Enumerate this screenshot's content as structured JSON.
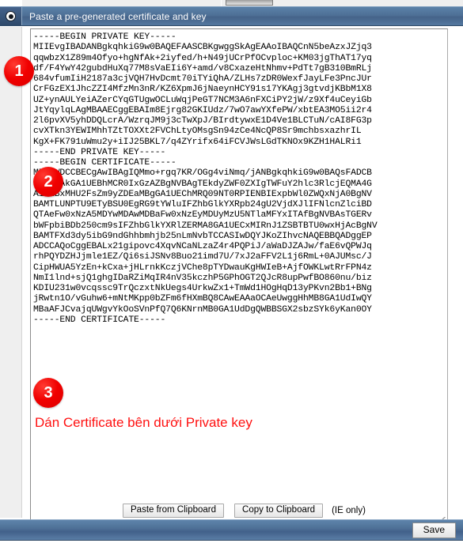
{
  "window": {
    "title": "Paste a pre-generated certificate and key",
    "title_icon": "radio-selected-icon",
    "accent_color": "#4e7096",
    "badge_color": "#f00000",
    "annotation_color": "#ff1010"
  },
  "editor": {
    "name": "certificate-and-key-textarea",
    "placeholder": "",
    "value": "-----BEGIN PRIVATE KEY-----\nMIIEvgIBADANBgkqhkiG9w0BAQEFAASCBKgwggSkAgEAAoIBAQCnN5beAzxJZjq3\nqqwbzX1Z89m4Ofyo+hgNfAk+2iyfed/h+N49jUCrPfOCvploc+KM03jgThAT17yq\ndf/F4YwY42gubdHuXq77M8sVaEIi6Y+amd/v8CxazeHtNhmv+PdTt7gB310BmRLj\n684vfumIiH2187a3cjVQH7HvDcmt70iTYiQhA/ZLHs7zDR0WexfJayLFe3PncJUr\nCrFGzEX1JhcZZI4MfzMn3nR/KZ6XpmJ6jNaeynHCY91s17YKAgj3gtvdjKBbM1X8\nUZ+ynAULYeiAZerCYqGTUgwOCLuWqjPeGT7NCM3A6nFXCiPY2jW/z9Xf4uCeyiGb\nJtYqylqLAgMBAAECggEBAIm8Ejrg82GKIUdz/7wO7awYXfePW/xbtEA3MO5ii2r4\n2l6pvXV5yhDDQLcrA/WzrqJM9j3cTwXpJ/BIrdtywxE1D4Ve1BLCTuN/cAI8FG3p\ncvXTkn3YEWIMhhTZtTOXXt2FVChLtyOMsgSn94zCe4NcQP8Sr9mchbsxazhrIL\nKgX+FK791uWmu2y+iIJ25BKL7/q4ZYrifx64iFCVJWsLGdTKNOx9KZH1HALRi1\n-----END PRIVATE KEY-----\n-----BEGIN CERTIFICATE-----\nMIIFWDCCBECgAwIBAgIQMmo+rgq7KR/OGg4viNmq/jANBgkqhkiG9w0BAQsFADCB\nkDELMAkGA1UEBhMCR0IxGzAZBgNVBAgTEkdyZWF0ZXIgTWFuY2hlc3RlcjEQMA4G\nA1UEBxMHU2FsZm9yZDEaMBgGA1UEChMRQ09NT0RPIENBIExpbWl0ZWQxNjA0BgNV\nBAMTLUNPTU9ETyBSU0EgRG9tYWluIFZhbGlkYXRpb24gU2VjdXJlIFNlcnZlciBD\nQTAeFw0xNzA5MDYwMDAwMDBaFw0xNzEyMDUyMzU5NTlaMFYxITAfBgNVBAsTGERv\nbWFpbiBDb250cm9sIFZhbGlkYXRlZERMA8GA1UECxMIRnJ1ZSBTBTU0wxHjAcBgNV\nBAMTFXd3dy5ibG9ndGhhbmhjb25nLmNvbTCCASIwDQYJKoZIhvcNAQEBBQADggEP\nADCCAQoCggEBALx21gipovc4XqvNCaNLzaZ4r4PQPiJ/aWaDJZAJw/faE6vQPWJq\nrhPQYDZHJjmle1EZ/Qi6siJSNv8Buo21imd7U/7xJ2aFFV2L1j6RmL+0AJUMsc/J\nCipHWUA5YzEn+kCxa+jHLrnkKczjVChe8pTYDwauKgHWIeB+AjfOWKLwtRrFPN4z\nNmI1lnd+sjQ1ghgIDaRZiMqIR4nV35kczhP5GPhOGT2QJcR8upPwfBO860nu/biz\nKDIU231w0vcqssc9TrQczxtNkUegs4UrkwZx1+TmWd1HOgHqD13yPKvn2Bb1+BNg\njRwtn1O/vGuhw6+mNtMKpp0bZFm6fHXmBQ8CAwEAAaOCAeUwggHhMB8GA1UdIwQY\nMBaAFJCvajqUWgvYkOoSVnPfQ7Q6KNrnMB0GA1UdDgQWBBSGX2sbzSYk6yKan0OY\n-----END CERTIFICATE-----"
  },
  "annotation": {
    "note": "Dán Certificate bên dưới Private key",
    "badges": [
      "1",
      "2",
      "3"
    ]
  },
  "actions": {
    "paste_from_clipboard": "Paste from Clipboard",
    "copy_to_clipboard": "Copy to Clipboard",
    "ie_only_note": "(IE only)",
    "save": "Save"
  }
}
